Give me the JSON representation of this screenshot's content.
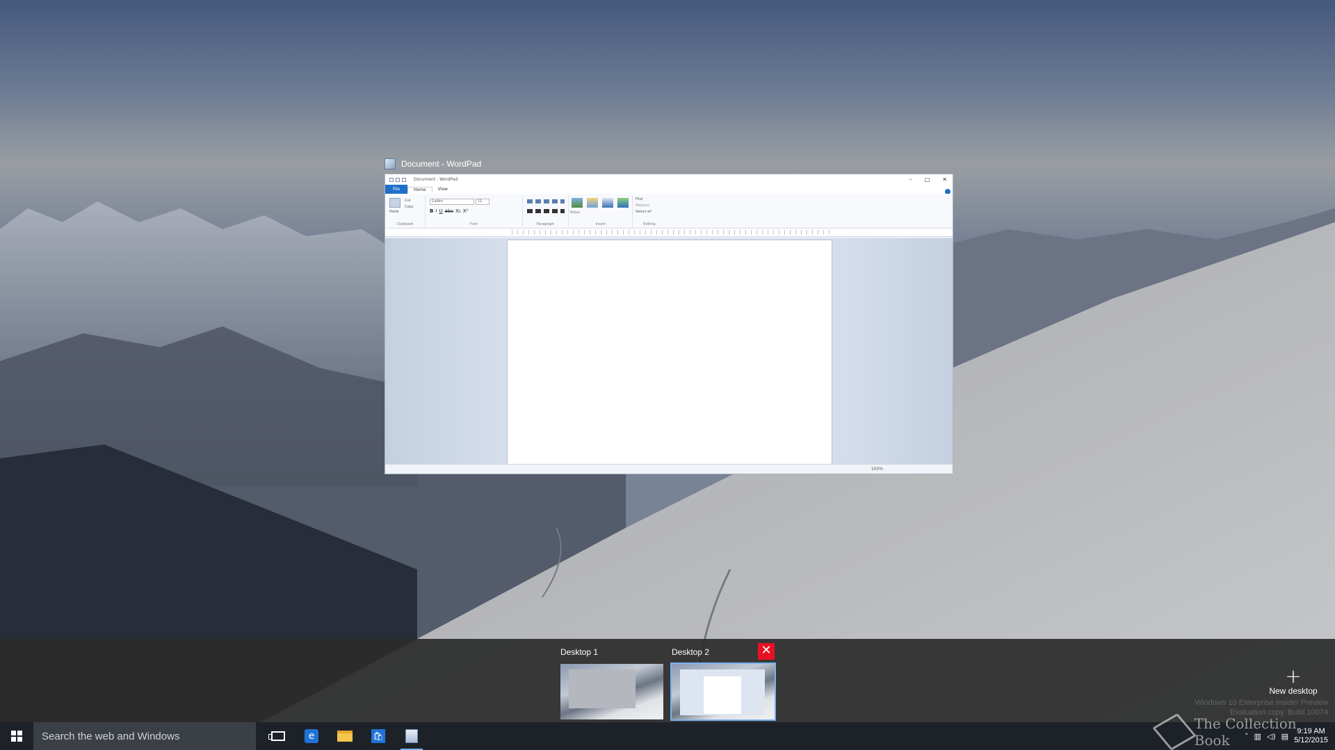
{
  "window": {
    "title": "Document - WordPad",
    "inner_title": "Document - WordPad",
    "tabs": [
      "File",
      "Home",
      "View"
    ],
    "ribbon": {
      "clipboard": {
        "paste": "Paste",
        "cut": "Cut",
        "copy": "Copy",
        "label": "Clipboard"
      },
      "font": {
        "family": "Calibri",
        "size": "11",
        "label": "Font",
        "bold": "B",
        "italic": "I",
        "underline": "U",
        "strike": "abc",
        "sub": "X₂",
        "sup": "X²"
      },
      "paragraph": {
        "label": "Paragraph"
      },
      "insert": {
        "picture": "Picture",
        "paint": "Paint drawing",
        "datetime": "Date and time",
        "object": "Insert object",
        "label": "Insert"
      },
      "editing": {
        "find": "Find",
        "replace": "Replace",
        "select_all": "Select all",
        "label": "Editing"
      }
    },
    "zoom": "100%"
  },
  "desktops": [
    {
      "label": "Desktop 1",
      "active": false
    },
    {
      "label": "Desktop 2",
      "active": true
    }
  ],
  "new_desktop_label": "New desktop",
  "close_symbol": "✕",
  "plus_symbol": "+",
  "taskbar": {
    "search_placeholder": "Search the web and Windows",
    "store_glyph": "🛍",
    "ie_glyph": "e"
  },
  "tray": {
    "time": "9:19 AM",
    "date": "5/12/2015"
  },
  "watermark": {
    "line1": "Windows 10 Enterprise Insider Preview",
    "line2": "Evaluation copy. Build 10074"
  },
  "brand": "The Collection Book",
  "colors": {
    "accent": "#1e6fc9",
    "close_red": "#e81123",
    "taskbar": "#1d2228",
    "active_outline": "#7bb2ee"
  },
  "icons": [
    "windows-logo-icon",
    "task-view-icon",
    "internet-explorer-icon",
    "file-explorer-icon",
    "store-icon",
    "wordpad-icon",
    "network-icon",
    "volume-icon",
    "action-center-icon"
  ]
}
